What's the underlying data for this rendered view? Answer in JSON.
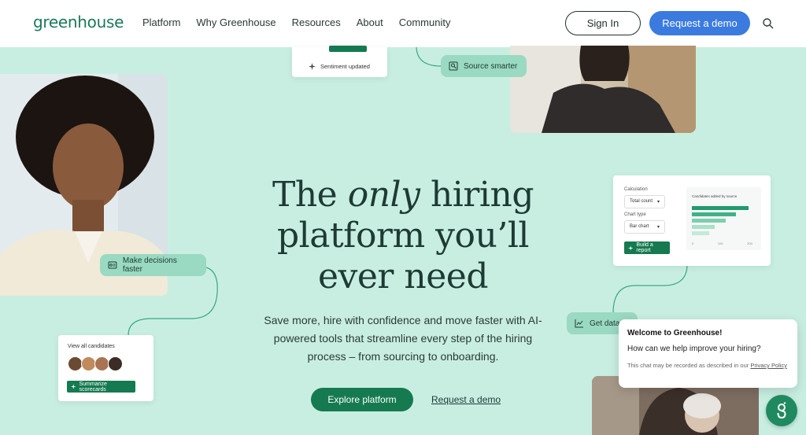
{
  "header": {
    "logo": "greenhouse",
    "nav": [
      "Platform",
      "Why Greenhouse",
      "Resources",
      "About",
      "Community"
    ],
    "sign_in": "Sign In",
    "request_demo": "Request a demo"
  },
  "hero": {
    "title_part1": "The ",
    "title_em": "only",
    "title_part2": " hiring",
    "title_line2": "platform you’ll",
    "title_line3": "ever need",
    "subtitle": "Save more, hire with confidence and move faster with AI-powered tools that streamline every step of the hiring process – from sourcing to onboarding.",
    "explore": "Explore platform",
    "demo_link": "Request a demo"
  },
  "cards": {
    "sentiment": "Sentiment updated",
    "source_smarter": "Source smarter",
    "make_decisions": "Make decisions faster",
    "view_candidates": "View all candidates",
    "summarize": "Summarize scorecards",
    "get_data": "Get data",
    "report": {
      "calculation_label": "Calculation",
      "calculation_value": "Total count",
      "chart_type_label": "Chart type",
      "chart_type_value": "Bar chart",
      "build_button": "Build a report",
      "chart_title": "Candidates added by source",
      "axis_ticks": [
        "0",
        "100",
        "200"
      ],
      "bars": [
        1.0,
        0.78,
        0.6,
        0.4,
        0.3
      ]
    }
  },
  "chat": {
    "title": "Welcome to Greenhouse!",
    "question": "How can we help improve your hiring?",
    "note": "This chat may be recorded as described in our ",
    "privacy": "Privacy Policy"
  },
  "colors": {
    "background": "#c8eee2",
    "accent_green": "#157a50",
    "demo_blue": "#3b7be0",
    "pill_green": "#9ad9c2"
  }
}
